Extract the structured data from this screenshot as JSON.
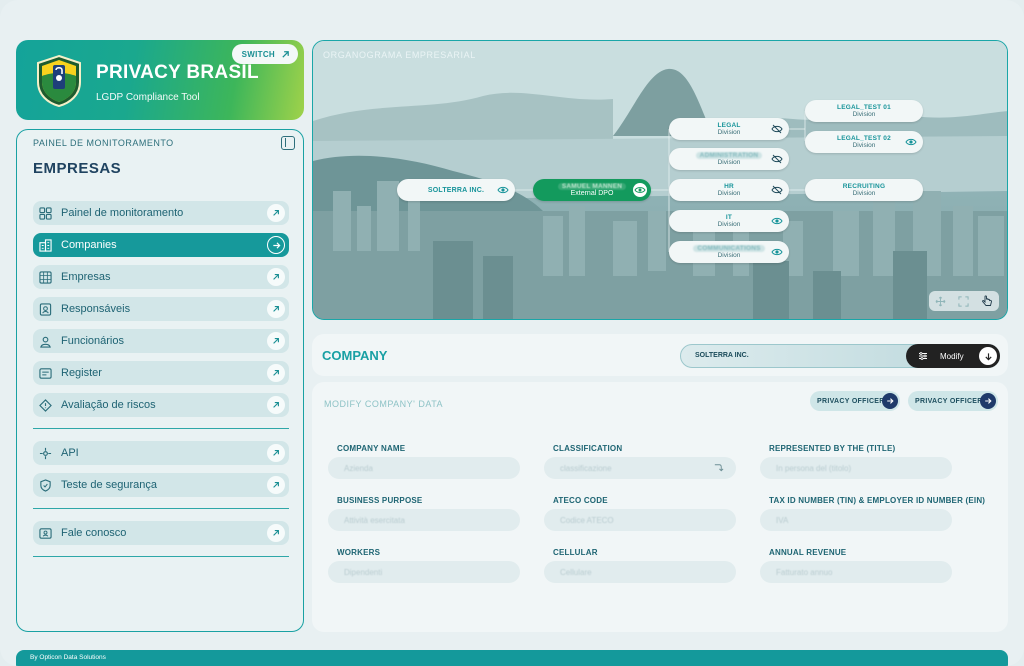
{
  "brand": {
    "title": "PRIVACY BRASIL",
    "subtitle": "LGDP Compliance Tool",
    "switch_label": "SWITCH",
    "colors": {
      "gradient_start": "#14a39a",
      "gradient_end": "#9fd24a"
    }
  },
  "sidebar": {
    "panel_label": "PAINEL DE MONITORAMENTO",
    "section_title": "EMPRESAS",
    "items": [
      {
        "label": "Painel de monitoramento",
        "icon": "dashboard-icon",
        "active": false
      },
      {
        "label": "Companies",
        "icon": "building-icon",
        "active": true
      },
      {
        "label": "Empresas",
        "icon": "grid-icon",
        "active": false
      },
      {
        "label": "Responsáveis",
        "icon": "person-badge-icon",
        "active": false
      },
      {
        "label": "Funcionários",
        "icon": "worker-icon",
        "active": false
      },
      {
        "label": "Register",
        "icon": "register-icon",
        "active": false
      },
      {
        "label": "Avaliação de riscos",
        "icon": "risk-diamond-icon",
        "active": false
      },
      {
        "label": "API",
        "icon": "api-icon",
        "active": false
      },
      {
        "label": "Teste de segurança",
        "icon": "security-shield-icon",
        "active": false
      },
      {
        "label": "Fale conosco",
        "icon": "contact-icon",
        "active": false
      }
    ]
  },
  "org": {
    "title": "ORGANOGRAMA EMPRESARIAL",
    "root": {
      "name": "SOLTERRA INC.",
      "visible": true
    },
    "dpo": {
      "name": "SAMUEL MANNEN",
      "role": "External DPO"
    },
    "divisions": [
      {
        "name": "LEGAL",
        "type": "Division",
        "visible": false,
        "blurred": false
      },
      {
        "name": "ADMINISTRATION",
        "type": "Division",
        "visible": false,
        "blurred": true
      },
      {
        "name": "HR",
        "type": "Division",
        "visible": false,
        "blurred": false
      },
      {
        "name": "IT",
        "type": "Division",
        "visible": true,
        "blurred": false
      },
      {
        "name": "COMMUNICATIONS",
        "type": "Division",
        "visible": true,
        "blurred": true
      }
    ],
    "subdivisions": [
      {
        "name": "LEGAL_TEST 01",
        "type": "Division",
        "visible": null
      },
      {
        "name": "LEGAL_TEST 02",
        "type": "Division",
        "visible": true
      },
      {
        "name": "RECRUITING",
        "type": "Division",
        "visible": null
      }
    ]
  },
  "company_bar": {
    "title": "COMPANY",
    "selected_company": "SOLTERRA INC.",
    "modify_label": "Modify"
  },
  "form": {
    "title": "MODIFY COMPANY' DATA",
    "privacy_officer_buttons": [
      "PRIVACY OFFICER",
      "PRIVACY OFFICER"
    ],
    "fields": [
      {
        "label": "COMPANY NAME",
        "placeholder": "Azienda",
        "dropdown": false
      },
      {
        "label": "CLASSIFICATION",
        "placeholder": "classificazione",
        "dropdown": true
      },
      {
        "label": "REPRESENTED BY THE (TITLE)",
        "placeholder": "In persona del (titolo)",
        "dropdown": false
      },
      {
        "label": "BUSINESS PURPOSE",
        "placeholder": "Attività esercitata",
        "dropdown": false
      },
      {
        "label": "ATECO CODE",
        "placeholder": "Codice ATECO",
        "dropdown": false
      },
      {
        "label": "TAX ID NUMBER (TIN) & EMPLOYER ID NUMBER (EIN)",
        "placeholder": "IVA",
        "dropdown": false
      },
      {
        "label": "WORKERS",
        "placeholder": "Dipendenti",
        "dropdown": false
      },
      {
        "label": "CELLULAR",
        "placeholder": "Cellulare",
        "dropdown": false
      },
      {
        "label": "ANNUAL REVENUE",
        "placeholder": "Fatturato annuo",
        "dropdown": false
      }
    ]
  },
  "footer": {
    "text": "By Opticon Data Solutions"
  },
  "colors": {
    "accent": "#16999b",
    "dark": "#222222",
    "navy": "#1f3a6a",
    "dpo_green": "#139a5d"
  }
}
